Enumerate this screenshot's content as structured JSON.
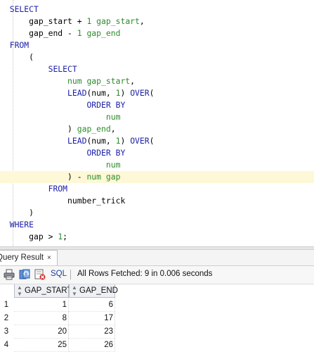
{
  "editor": {
    "lines": [
      [
        [
          "kw",
          "SELECT"
        ]
      ],
      [
        [
          "id",
          "    gap_start "
        ],
        [
          "op",
          "+ "
        ],
        [
          "num",
          "1"
        ],
        [
          "alias",
          " gap_start"
        ],
        [
          "op",
          ","
        ]
      ],
      [
        [
          "id",
          "    gap_end "
        ],
        [
          "op",
          "- "
        ],
        [
          "num",
          "1"
        ],
        [
          "alias",
          " gap_end"
        ]
      ],
      [
        [
          "kw",
          "FROM"
        ]
      ],
      [
        [
          "op",
          "    ("
        ]
      ],
      [
        [
          "kw",
          "        SELECT"
        ]
      ],
      [
        [
          "alias",
          "            num gap_start"
        ],
        [
          "op",
          ","
        ]
      ],
      [
        [
          "fn",
          "            LEAD"
        ],
        [
          "op",
          "(num, "
        ],
        [
          "num",
          "1"
        ],
        [
          "op",
          ") "
        ],
        [
          "kw",
          "OVER"
        ],
        [
          "op",
          "("
        ]
      ],
      [
        [
          "kw",
          "                ORDER BY"
        ]
      ],
      [
        [
          "alias",
          "                    num"
        ]
      ],
      [
        [
          "op",
          "            ) "
        ],
        [
          "alias",
          "gap_end"
        ],
        [
          "op",
          ","
        ]
      ],
      [
        [
          "fn",
          "            LEAD"
        ],
        [
          "op",
          "(num, "
        ],
        [
          "num",
          "1"
        ],
        [
          "op",
          ") "
        ],
        [
          "kw",
          "OVER"
        ],
        [
          "op",
          "("
        ]
      ],
      [
        [
          "kw",
          "                ORDER BY"
        ]
      ],
      [
        [
          "alias",
          "                    num"
        ]
      ],
      [
        [
          "op",
          "            ) - "
        ],
        [
          "alias",
          "num gap"
        ]
      ],
      [
        [
          "kw",
          "        FROM"
        ]
      ],
      [
        [
          "id",
          "            number_trick"
        ]
      ],
      [
        [
          "op",
          "    )"
        ]
      ],
      [
        [
          "kw",
          "WHERE"
        ]
      ],
      [
        [
          "id",
          "    gap "
        ],
        [
          "op",
          "> "
        ],
        [
          "num",
          "1"
        ],
        [
          "op",
          ";"
        ]
      ]
    ],
    "highlighted_line": 14
  },
  "result_panel": {
    "tab_label": "Query Result",
    "tab_close": "×",
    "toolbar": {
      "sql_label": "SQL",
      "status": "All Rows Fetched: 9 in 0.006 seconds"
    },
    "grid": {
      "columns": [
        "GAP_START",
        "GAP_END"
      ],
      "rows": [
        {
          "n": "1",
          "cells": [
            "1",
            "6"
          ]
        },
        {
          "n": "2",
          "cells": [
            "8",
            "17"
          ]
        },
        {
          "n": "3",
          "cells": [
            "20",
            "23"
          ]
        },
        {
          "n": "4",
          "cells": [
            "25",
            "26"
          ]
        }
      ]
    }
  },
  "colors": {
    "keyword": "#1d20a8",
    "number": "#2e8b2e",
    "highlight": "#fdf8d6"
  },
  "icons": [
    "print-icon",
    "refresh-sql-icon",
    "clear-results-icon"
  ]
}
